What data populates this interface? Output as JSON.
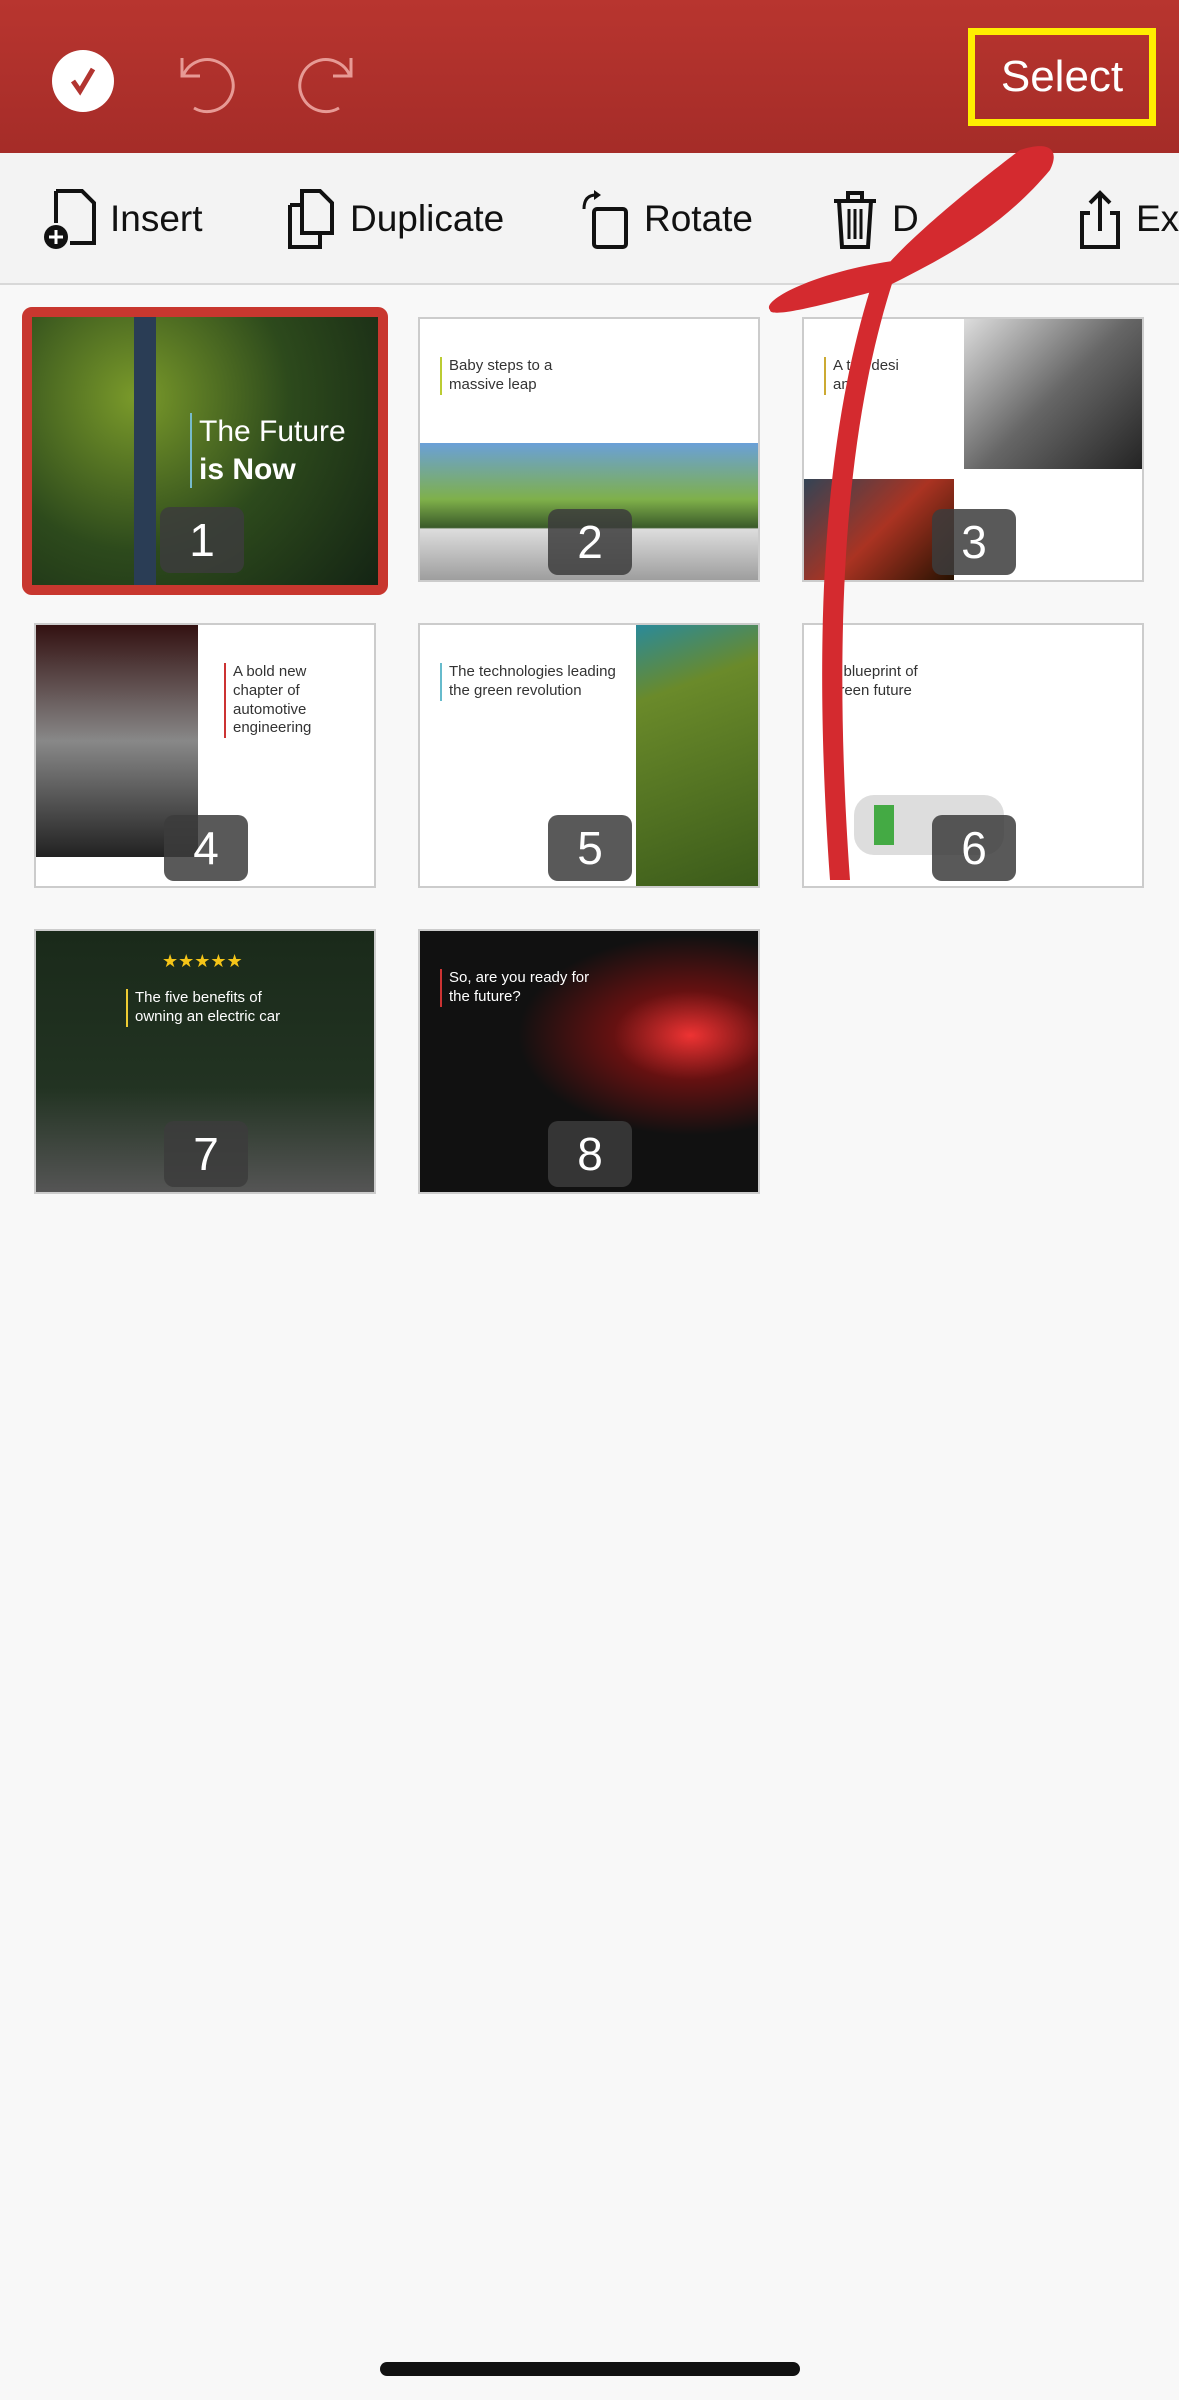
{
  "header": {
    "select_label": "Select",
    "icons": [
      "checkmark-icon",
      "undo-icon",
      "redo-icon"
    ]
  },
  "toolbar": {
    "items": [
      {
        "label": "Insert",
        "icon": "insert-page-icon"
      },
      {
        "label": "Duplicate",
        "icon": "duplicate-icon"
      },
      {
        "label": "Rotate",
        "icon": "rotate-icon"
      },
      {
        "label": "D",
        "icon": "trash-icon"
      },
      {
        "label": "Ex",
        "icon": "share-icon"
      }
    ]
  },
  "slides": [
    {
      "number": "1",
      "title": "The Future",
      "title2": "is Now",
      "selected": true
    },
    {
      "number": "2",
      "title": "Baby steps to a massive leap"
    },
    {
      "number": "3",
      "title": "A triu desi and"
    },
    {
      "number": "4",
      "title": "A bold new chapter of automotive engineering"
    },
    {
      "number": "5",
      "title": "The technologies leading the green revolution"
    },
    {
      "number": "6",
      "title": "e blueprint of green future"
    },
    {
      "number": "7",
      "title": "The five benefits of owning an electric car",
      "stars": "★★★★★"
    },
    {
      "number": "8",
      "title": "So, are you ready for the future?"
    }
  ],
  "colors": {
    "accent": "#b23430",
    "highlight": "#ffee00",
    "annotation": "#d42a2f"
  }
}
